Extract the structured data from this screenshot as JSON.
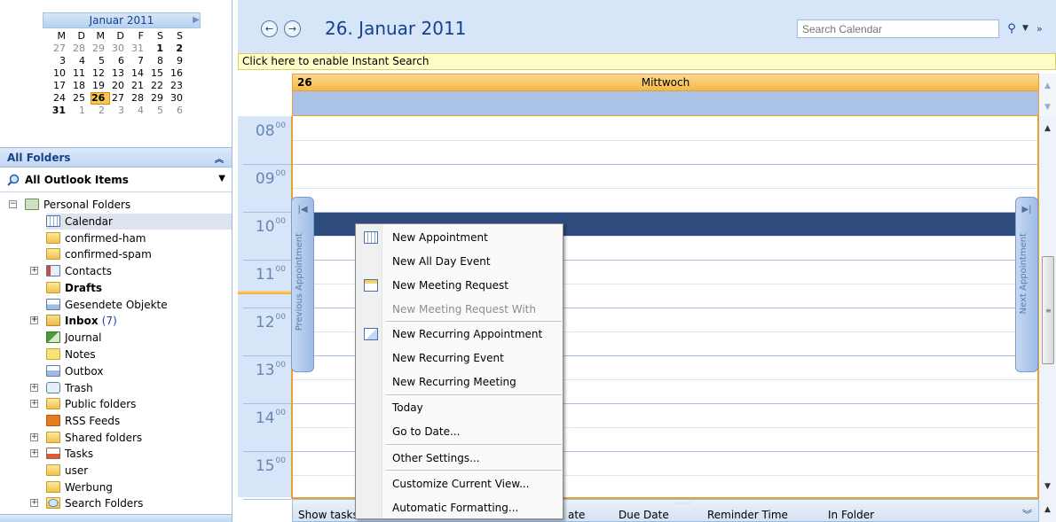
{
  "mini_calendar": {
    "month_label": "Januar 2011",
    "weekdays": [
      "M",
      "D",
      "M",
      "D",
      "F",
      "S",
      "S"
    ],
    "weeks": [
      [
        "27",
        "28",
        "29",
        "30",
        "31",
        "1",
        "2"
      ],
      [
        "3",
        "4",
        "5",
        "6",
        "7",
        "8",
        "9"
      ],
      [
        "10",
        "11",
        "12",
        "13",
        "14",
        "15",
        "16"
      ],
      [
        "17",
        "18",
        "19",
        "20",
        "21",
        "22",
        "23"
      ],
      [
        "24",
        "25",
        "26",
        "27",
        "28",
        "29",
        "30"
      ],
      [
        "31",
        "1",
        "2",
        "3",
        "4",
        "5",
        "6"
      ]
    ],
    "selected_day": "26"
  },
  "nav": {
    "section_title": "All Folders",
    "view_selector": "All Outlook Items",
    "folders": {
      "personal": "Personal Folders",
      "calendar": "Calendar",
      "confirmed_ham": "confirmed-ham",
      "confirmed_spam": "confirmed-spam",
      "contacts": "Contacts",
      "drafts": "Drafts",
      "sent": "Gesendete Objekte",
      "inbox": "Inbox",
      "inbox_count": "(7)",
      "journal": "Journal",
      "notes": "Notes",
      "outbox": "Outbox",
      "trash": "Trash",
      "public": "Public folders",
      "rss": "RSS Feeds",
      "shared": "Shared folders",
      "tasks": "Tasks",
      "user": "user",
      "werbung": "Werbung",
      "search": "Search Folders"
    }
  },
  "calendar": {
    "date_title": "26. Januar 2011",
    "search_placeholder": "Search Calendar",
    "instant_search_bar": "Click here to enable Instant Search",
    "day_number": "26",
    "day_name": "Mittwoch",
    "hours": [
      "08",
      "09",
      "10",
      "11",
      "12",
      "13",
      "14",
      "15"
    ],
    "minute_suffix": "00",
    "previous_tab": "Previous Appointment",
    "next_tab": "Next Appointment",
    "task_columns": {
      "show_tasks": "Show tasks",
      "start_date": "ate",
      "due_date": "Due Date",
      "reminder": "Reminder Time",
      "folder": "In Folder"
    }
  },
  "context_menu": {
    "items": [
      {
        "label": "New Appointment",
        "icon": "calendar-icon"
      },
      {
        "label": "New All Day Event"
      },
      {
        "label": "New Meeting Request",
        "icon": "meeting-icon"
      },
      {
        "label": "New Meeting Request With",
        "disabled": true
      },
      {
        "label": "New Recurring Appointment",
        "icon": "recurring-icon"
      },
      {
        "label": "New Recurring Event"
      },
      {
        "label": "New Recurring Meeting"
      },
      {
        "label": "Today"
      },
      {
        "label": "Go to Date..."
      },
      {
        "label": "Other Settings..."
      },
      {
        "label": "Customize Current View..."
      },
      {
        "label": "Automatic Formatting..."
      }
    ]
  },
  "colors": {
    "accent": "#15428b",
    "selection": "#2e4b7e",
    "today_highlight": "#f6c65e",
    "instant_search_bg": "#fffdc8"
  }
}
